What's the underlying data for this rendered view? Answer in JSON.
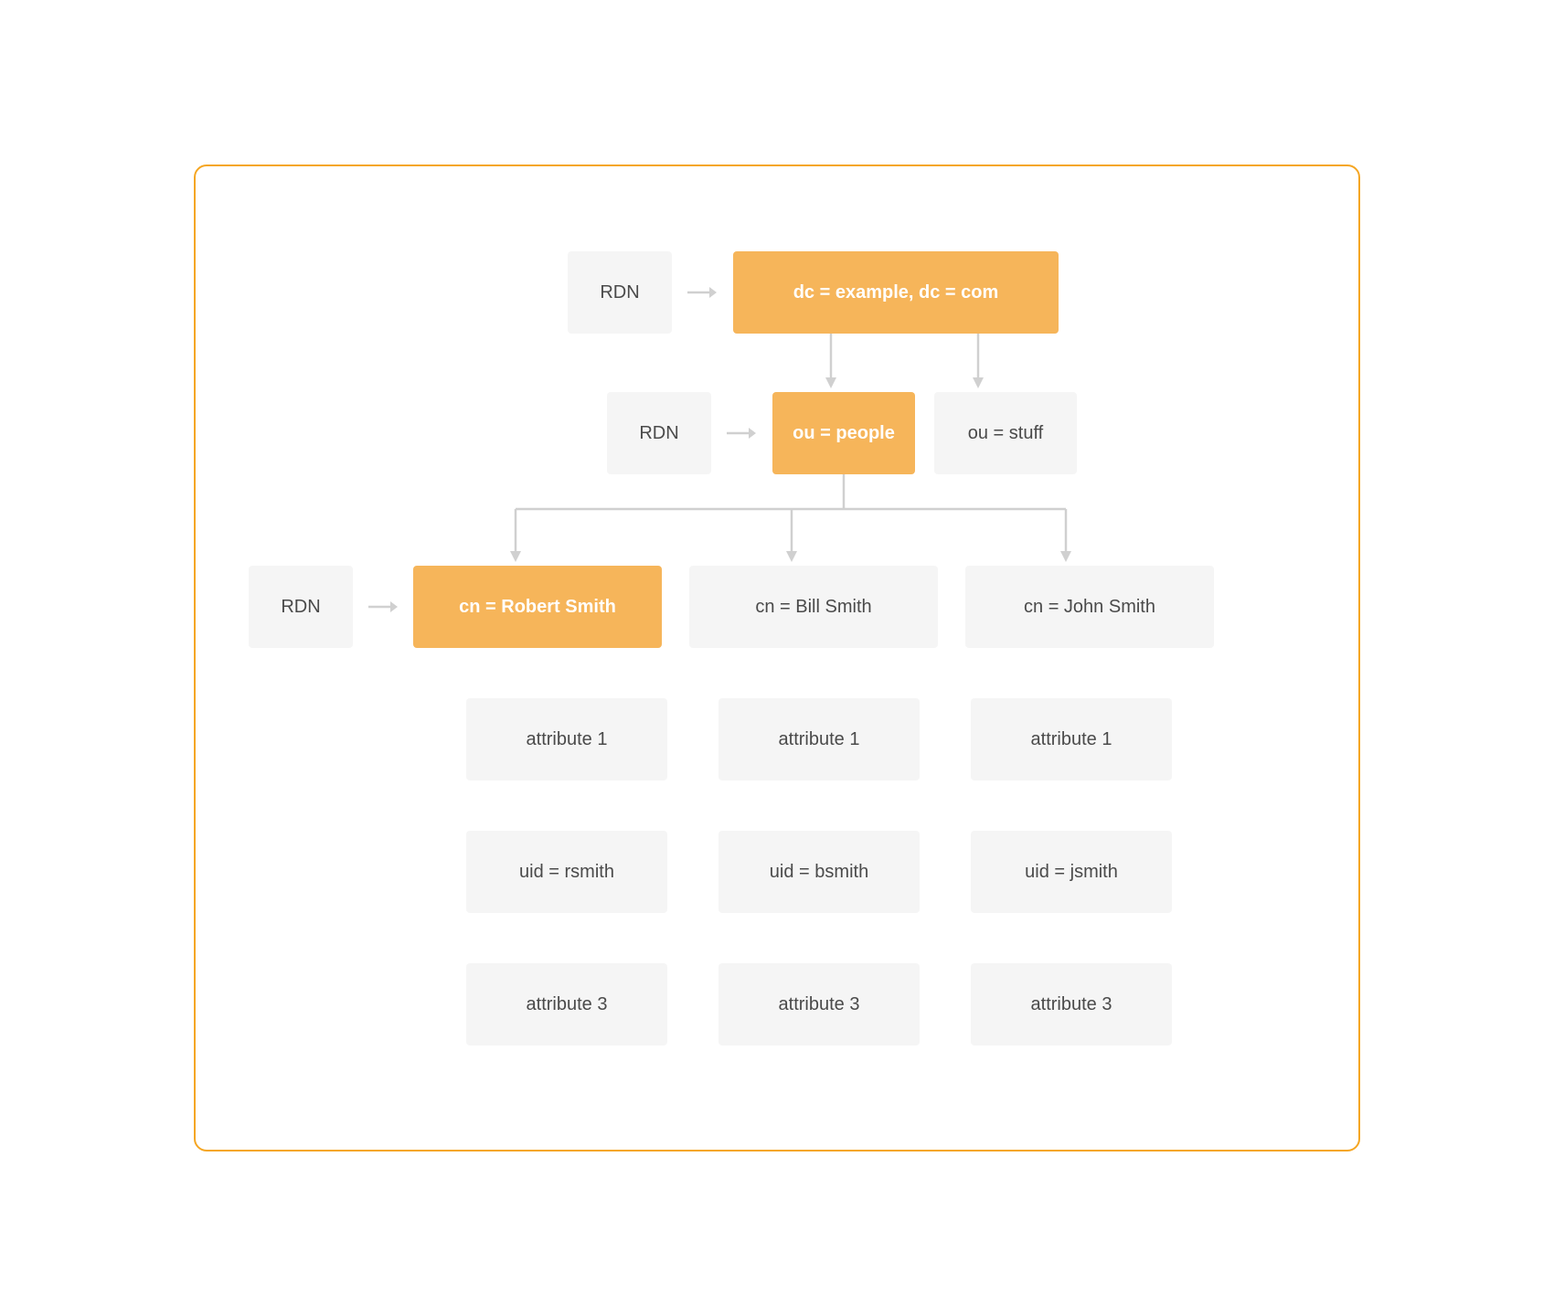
{
  "rdn_label": "RDN",
  "root": {
    "label": "dc = example, dc = com"
  },
  "level2": {
    "people": "ou = people",
    "stuff": "ou = stuff"
  },
  "entries": [
    {
      "cn": "cn = Robert Smith",
      "highlighted": true,
      "attrs": [
        "attribute 1",
        "uid = rsmith",
        "attribute 3"
      ]
    },
    {
      "cn": "cn = Bill Smith",
      "highlighted": false,
      "attrs": [
        "attribute 1",
        "uid = bsmith",
        "attribute 3"
      ]
    },
    {
      "cn": "cn = John Smith",
      "highlighted": false,
      "attrs": [
        "attribute 1",
        "uid = jsmith",
        "attribute 3"
      ]
    }
  ],
  "colors": {
    "accent": "#f6b55a",
    "border": "#f5a623",
    "nodeGray": "#f5f5f5",
    "text": "#4a4a4a",
    "connector": "#d0d0d0"
  }
}
